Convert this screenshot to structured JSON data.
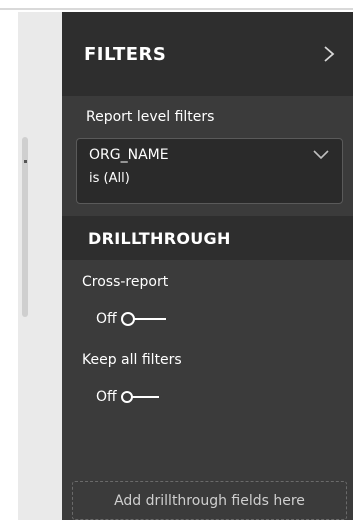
{
  "filters_pane": {
    "title": "FILTERS",
    "collapse_glyph": ">",
    "report_level_label": "Report level filters",
    "filter_card": {
      "field": "ORG_NAME",
      "condition": "is (All)",
      "chevron_icon": "chevron-down-icon"
    }
  },
  "drillthrough": {
    "title": "DRILLTHROUGH",
    "cross_report": {
      "label": "Cross-report",
      "state": "Off",
      "on": false
    },
    "keep_all_filters": {
      "label": "Keep all filters",
      "state": "Off",
      "on": false
    },
    "dropzone_text": "Add drillthrough fields here"
  },
  "colors": {
    "pane_bg": "#3b3b3b",
    "header_bg": "#2e2e2e",
    "card_bg": "#2a2a2a",
    "gutter_bg": "#eaeaea"
  }
}
